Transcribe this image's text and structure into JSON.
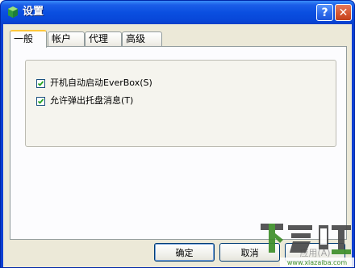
{
  "window": {
    "title": "设置",
    "help_glyph": "?",
    "close_glyph": "✕",
    "title_color": "#0a4fe0"
  },
  "tabs": [
    {
      "label": "一般",
      "active": true
    },
    {
      "label": "帐户",
      "active": false
    },
    {
      "label": "代理",
      "active": false
    },
    {
      "label": "高级",
      "active": false
    }
  ],
  "general": {
    "options": [
      {
        "label": "开机自动启动EverBox(S)",
        "checked": true
      },
      {
        "label": "允许弹出托盘消息(T)",
        "checked": true
      }
    ]
  },
  "buttons": {
    "ok_label": "确定",
    "cancel_label": "取消",
    "apply_label": "应用(A)"
  },
  "watermark": {
    "brand": "下载吧",
    "url": "www.xiazaiba.com"
  },
  "icons": {
    "app": "app-logo-icon",
    "help": "help-icon",
    "close": "close-icon",
    "check": "checkmark-icon"
  }
}
